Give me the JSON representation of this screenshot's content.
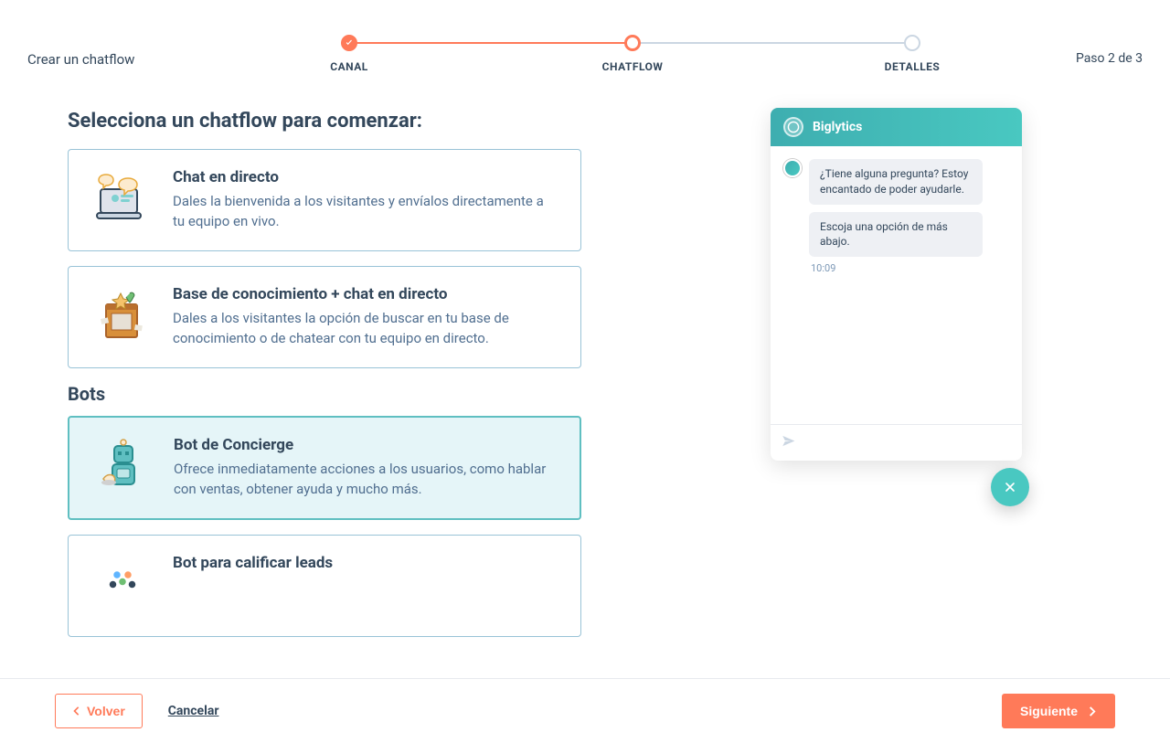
{
  "header": {
    "title": "Crear un chatflow",
    "step_text": "Paso 2 de 3"
  },
  "stepper": {
    "step1": "CANAL",
    "step2": "CHATFLOW",
    "step3": "DETALLES"
  },
  "section_title": "Selecciona un chatflow para comenzar:",
  "cards": {
    "live_chat": {
      "title": "Chat en directo",
      "desc": "Dales la bienvenida a los visitantes y envíalos directamente a tu equipo en vivo."
    },
    "kb_chat": {
      "title": "Base de conocimiento + chat en directo",
      "desc": "Dales a los visitantes la opción de buscar en tu base de conocimiento o de chatear con tu equipo en directo."
    },
    "bots_heading": "Bots",
    "concierge": {
      "title": "Bot de Concierge",
      "desc": "Ofrece inmediatamente acciones a los usuarios, como hablar con ventas, obtener ayuda y mucho más."
    },
    "qualify": {
      "title": "Bot para calificar leads"
    }
  },
  "chat": {
    "brand": "Biglytics",
    "msg1": "¿Tiene alguna pregunta? Estoy encantado de poder ayudarle.",
    "msg2": "Escoja una opción de más abajo.",
    "time": "10:09"
  },
  "footer": {
    "back": "Volver",
    "cancel": "Cancelar",
    "next": "Siguiente"
  }
}
